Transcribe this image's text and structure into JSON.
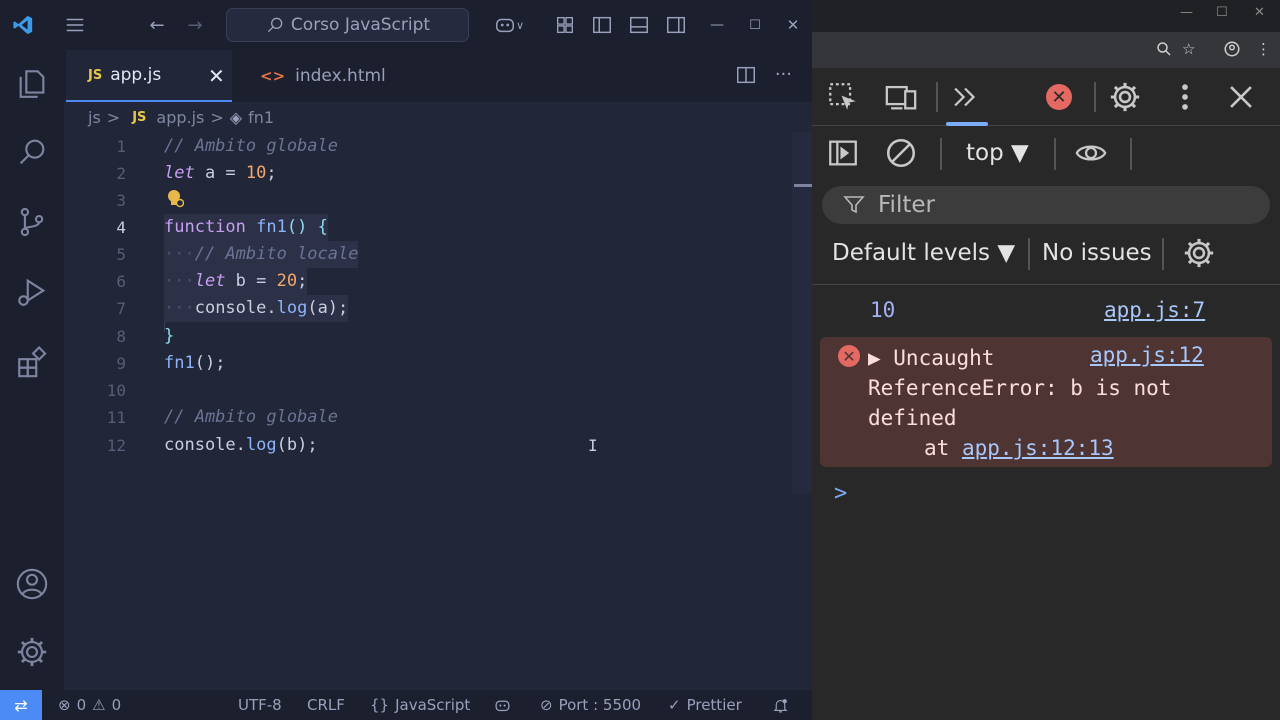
{
  "titlebar": {
    "search_text": "Corso JavaScript",
    "back": "←",
    "forward": "→",
    "minimize": "—",
    "maximize": "☐",
    "close": "✕"
  },
  "tabs": [
    {
      "badge": "JS",
      "label": "app.js",
      "close": "✕"
    },
    {
      "badge": "<>",
      "label": "index.html"
    }
  ],
  "breadcrumb": {
    "folder": "js",
    "sep": ">",
    "badge": "JS",
    "file": "app.js",
    "symbol": "fn1"
  },
  "editor": {
    "line_numbers": [
      "1",
      "2",
      "3",
      "4",
      "5",
      "6",
      "7",
      "8",
      "9",
      "10",
      "11",
      "12"
    ],
    "tokens": {
      "l1_comment": "// Ambito globale",
      "l2_kw": "let",
      "l2_rest": " a = ",
      "l2_num": "10",
      "l2_end": ";",
      "l4_kw": "function",
      "l4_fn": "fn1",
      "l4_end": "() {",
      "l5_indent": "···",
      "l5_comment": "// Ambito locale",
      "l6_indent": "···",
      "l6_kw": "let",
      "l6_rest": " b = ",
      "l6_num": "20",
      "l6_end": ";",
      "l7_indent": "···",
      "l7_obj": "console.",
      "l7_fn": "log",
      "l7_end": "(a);",
      "l8_brace": "}",
      "l9_fn": "fn1",
      "l9_end": "();",
      "l11_comment": "// Ambito globale",
      "l12_obj": "console.",
      "l12_fn": "log",
      "l12_end": "(b);"
    }
  },
  "statusbar": {
    "errors": "0",
    "warnings": "0",
    "encoding": "UTF-8",
    "eol": "CRLF",
    "braces": "{}",
    "language": "JavaScript",
    "port": "Port : 5500",
    "prettier": "Prettier"
  },
  "devtools": {
    "context": "top ▼",
    "filter_placeholder": "Filter",
    "levels": "Default levels ▼",
    "issues": "No issues",
    "log": {
      "value": "10",
      "source": "app.js:7"
    },
    "error": {
      "title": "▶ Uncaught",
      "source": "app.js:12",
      "message": "ReferenceError: b is not defined",
      "at": "at ",
      "at_link": "app.js:12:13"
    },
    "prompt": ">"
  }
}
